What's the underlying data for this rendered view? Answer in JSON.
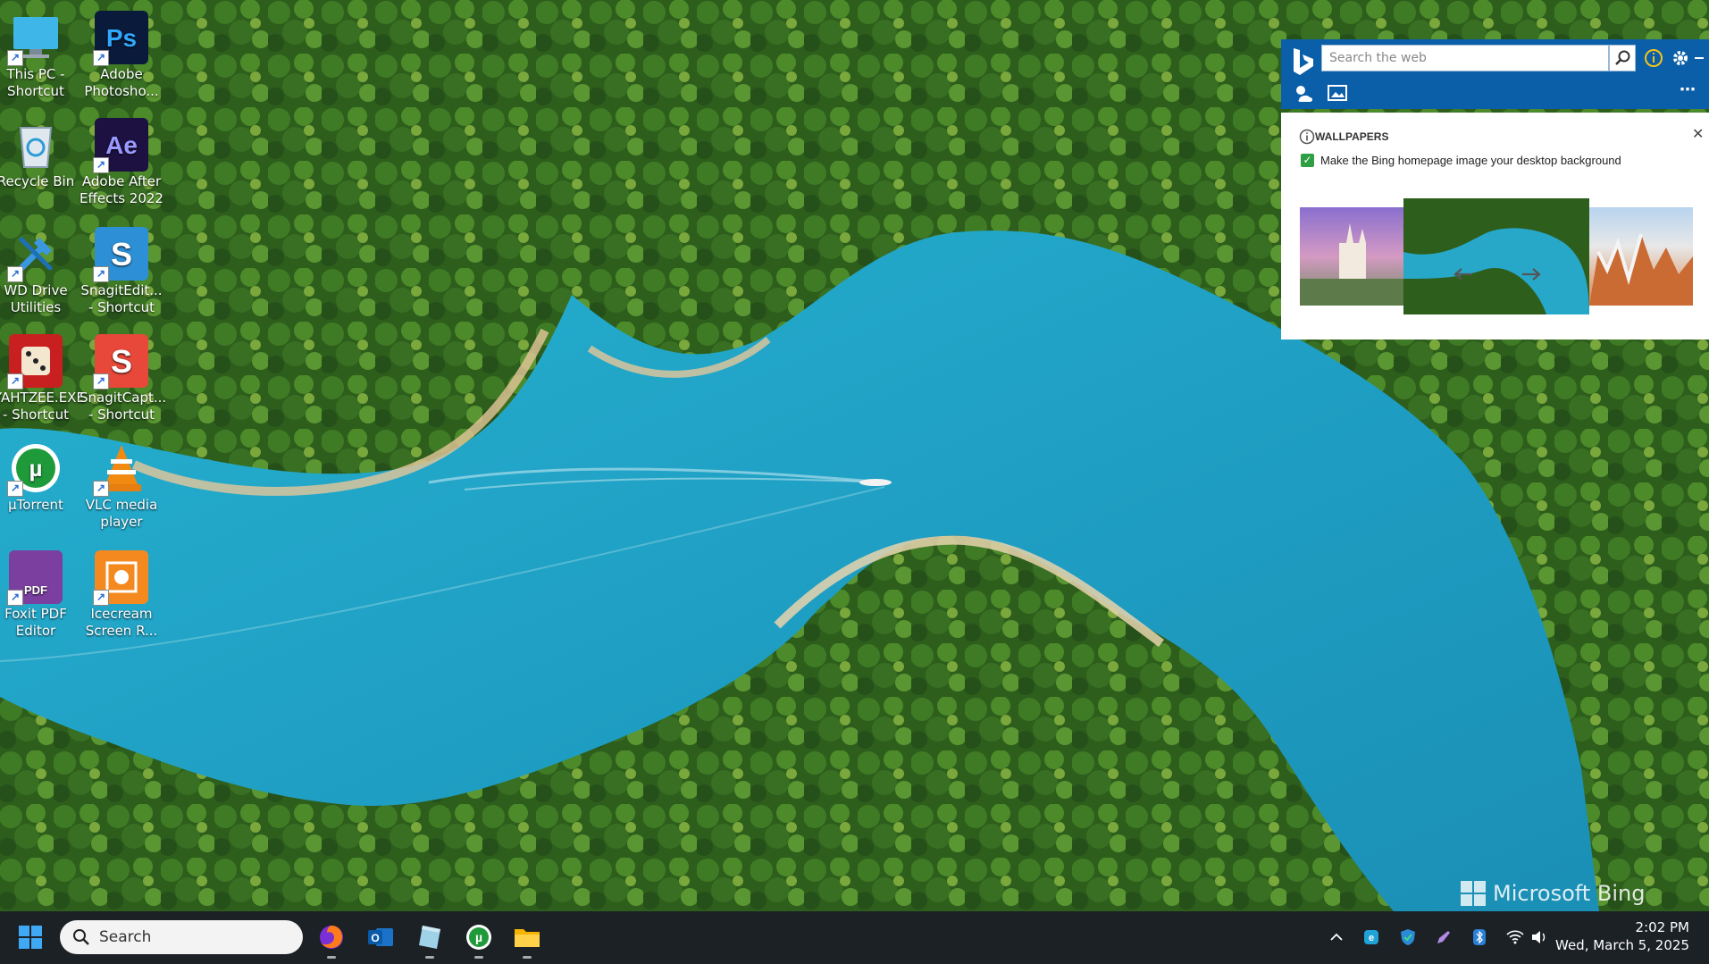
{
  "desktop": {
    "icons": [
      {
        "label": "This PC -\nShortcut",
        "name": "this-pc-shortcut"
      },
      {
        "label": "Adobe\nPhotosho...",
        "name": "adobe-photoshop-shortcut",
        "glyph": "Ps"
      },
      {
        "label": "Recycle Bin",
        "name": "recycle-bin"
      },
      {
        "label": "Adobe After\nEffects 2022",
        "name": "adobe-after-effects-shortcut",
        "glyph": "Ae"
      },
      {
        "label": "WD Drive\nUtilities",
        "name": "wd-drive-utilities-shortcut"
      },
      {
        "label": "SnagitEdit...\n- Shortcut",
        "name": "snagit-editor-shortcut",
        "glyph": "S"
      },
      {
        "label": "YAHTZEE.EXE\n- Shortcut",
        "name": "yahtzee-shortcut"
      },
      {
        "label": "SnagitCapt...\n- Shortcut",
        "name": "snagit-capture-shortcut",
        "glyph": "S"
      },
      {
        "label": "µTorrent",
        "name": "utorrent-shortcut"
      },
      {
        "label": "VLC media\nplayer",
        "name": "vlc-shortcut"
      },
      {
        "label": "Foxit PDF\nEditor",
        "name": "foxit-pdf-shortcut",
        "glyph": "PDF"
      },
      {
        "label": "Icecream\nScreen R...",
        "name": "icecream-screen-recorder-shortcut"
      }
    ]
  },
  "bing": {
    "search_placeholder": "Search the web",
    "wallpapers_title": "WALLPAPERS",
    "checkbox_label": "Make the Bing homepage image your desktop background",
    "icons": [
      "search-icon",
      "info-icon",
      "gear-icon",
      "minimize-icon",
      "weather-icon",
      "image-icon",
      "more-icon",
      "close-icon",
      "arrow-left-icon",
      "arrow-right-icon"
    ]
  },
  "watermark": {
    "text": "Microsoft Bing"
  },
  "taskbar": {
    "search_label": "Search",
    "apps": [
      "start-button",
      "firefox",
      "outlook",
      "notepad",
      "utorrent",
      "file-explorer"
    ],
    "clock_time": "2:02 PM",
    "clock_date": "Wed, March 5, 2025"
  },
  "colors": {
    "bing_blue": "#0b5ea8",
    "taskbar": "#1c2126",
    "water": "#2aa3c6",
    "forest": "#2f6a22"
  }
}
